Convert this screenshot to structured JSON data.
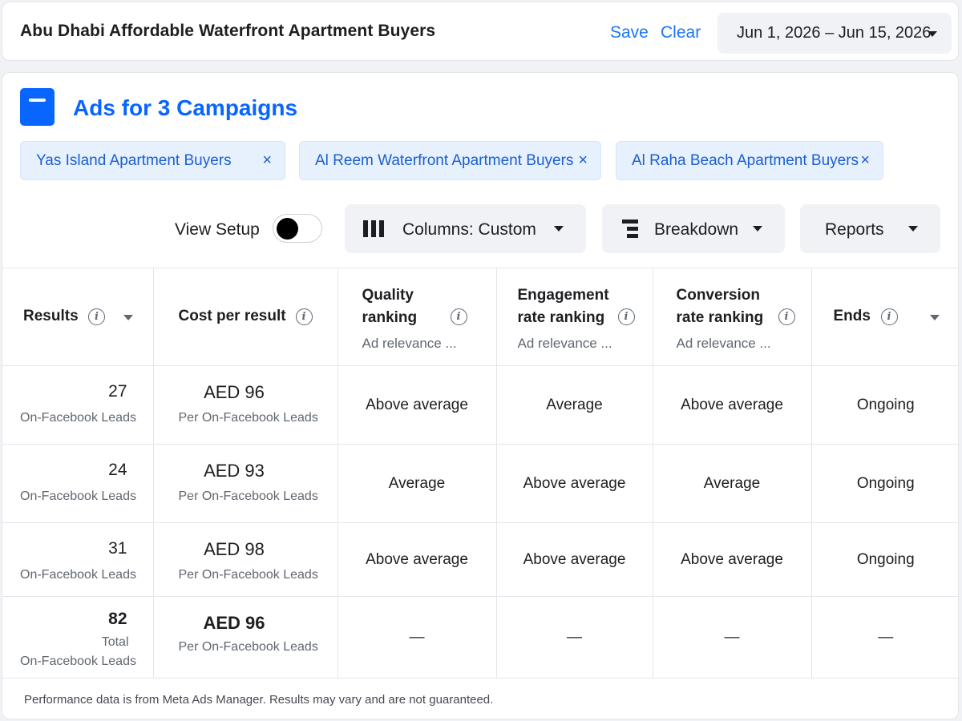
{
  "header": {
    "title": "Abu Dhabi Affordable Waterfront Apartment Buyers",
    "save_label": "Save",
    "clear_label": "Clear",
    "date_range": "Jun 1, 2026 – Jun 15, 2026"
  },
  "main": {
    "title": "Ads for 3 Campaigns",
    "chips": [
      {
        "label": "Yas Island Apartment Buyers"
      },
      {
        "label": "Al Reem Waterfront Apartment Buyers"
      },
      {
        "label": "Al Raha Beach Apartment Buyers"
      }
    ],
    "chip_close_glyph": "×"
  },
  "toolbar": {
    "view_setup_label": "View Setup",
    "columns_label": "Columns: Custom",
    "breakdown_label": "Breakdown",
    "reports_label": "Reports"
  },
  "table": {
    "headers": {
      "results": "Results",
      "cost_per_result": "Cost per result",
      "quality_1": "Quality",
      "quality_2": "ranking",
      "engagement_1": "Engagement",
      "engagement_2": "rate ranking",
      "conversion_1": "Conversion",
      "conversion_2": "rate ranking",
      "ends": "Ends",
      "sub": "Ad relevance ..."
    },
    "rows": [
      {
        "results": "27",
        "results_sub": "On-Facebook Leads",
        "cost": "AED 96",
        "cost_sub": "Per On-Facebook Leads",
        "quality": "Above average",
        "engagement": "Average",
        "conversion": "Above average",
        "ends": "Ongoing"
      },
      {
        "results": "24",
        "results_sub": "On-Facebook Leads",
        "cost": "AED 93",
        "cost_sub": "Per On-Facebook Leads",
        "quality": "Average",
        "engagement": "Above average",
        "conversion": "Average",
        "ends": "Ongoing"
      },
      {
        "results": "31",
        "results_sub": "On-Facebook Leads",
        "cost": "AED 98",
        "cost_sub": "Per On-Facebook Leads",
        "quality": "Above average",
        "engagement": "Above average",
        "conversion": "Above average",
        "ends": "Ongoing"
      }
    ],
    "total": {
      "results": "82",
      "results_sub1": "Total",
      "results_sub2": "On-Facebook Leads",
      "cost": "AED 96",
      "cost_sub": "Per On-Facebook Leads",
      "dash": "—"
    }
  },
  "footer": {
    "note": "Performance data is from Meta Ads Manager. Results may vary and are not guaranteed."
  },
  "colors": {
    "accent": "#0866ff",
    "chip_bg": "#e7f0fd",
    "chip_text": "#1b5fd1",
    "link": "#1877f2"
  },
  "icons": {
    "info": "info-circle-icon",
    "caret": "caret-down-icon",
    "close": "close-icon",
    "columns": "columns-icon",
    "breakdown": "breakdown-icon"
  }
}
